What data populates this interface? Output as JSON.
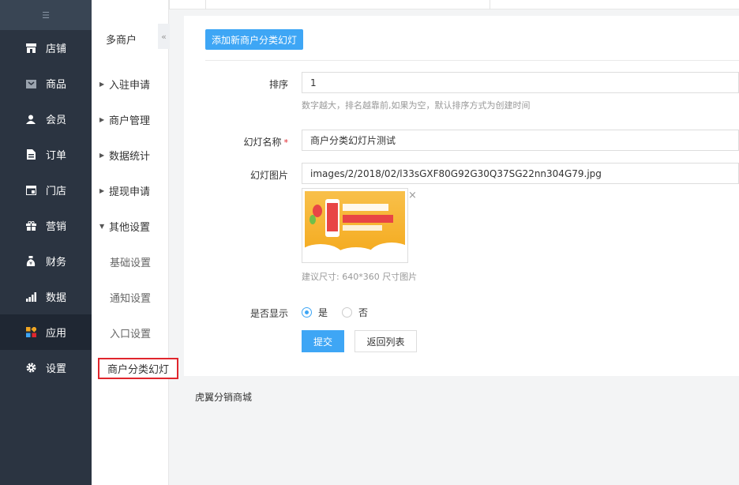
{
  "sidebar": {
    "toggle_glyph": "☰",
    "items": [
      {
        "label": "店铺",
        "icon": "store-icon"
      },
      {
        "label": "商品",
        "icon": "goods-icon"
      },
      {
        "label": "会员",
        "icon": "member-icon"
      },
      {
        "label": "订单",
        "icon": "order-icon"
      },
      {
        "label": "门店",
        "icon": "shop-icon"
      },
      {
        "label": "营销",
        "icon": "gift-icon"
      },
      {
        "label": "财务",
        "icon": "money-bag-icon"
      },
      {
        "label": "数据",
        "icon": "bar-chart-icon"
      },
      {
        "label": "应用",
        "icon": "apps-icon",
        "active": true
      },
      {
        "label": "设置",
        "icon": "gear-icon"
      }
    ]
  },
  "subnav": {
    "title": "多商户",
    "collapse_glyph": "«",
    "groups": [
      {
        "label": "入驻申请",
        "expanded": false
      },
      {
        "label": "商户管理",
        "expanded": false
      },
      {
        "label": "数据统计",
        "expanded": false
      },
      {
        "label": "提现申请",
        "expanded": false
      },
      {
        "label": "其他设置",
        "expanded": true
      }
    ],
    "children": [
      {
        "label": "基础设置"
      },
      {
        "label": "通知设置"
      },
      {
        "label": "入口设置"
      },
      {
        "label": "商户分类幻灯",
        "active": true
      }
    ]
  },
  "form": {
    "add_button": "添加新商户分类幻灯",
    "sort": {
      "label": "排序",
      "value": "1",
      "hint": "数字越大，排名越靠前,如果为空，默认排序方式为创建时间"
    },
    "name": {
      "label": "幻灯名称",
      "required_mark": "*",
      "value": "商户分类幻灯片测试"
    },
    "image": {
      "label": "幻灯图片",
      "value": "images/2/2018/02/l33sGXF80G92G30Q37SG22nn304G79.jpg",
      "hint": "建议尺寸: 640*360 尺寸图片",
      "remove_glyph": "×"
    },
    "display": {
      "label": "是否显示",
      "options": [
        {
          "label": "是",
          "checked": true
        },
        {
          "label": "否",
          "checked": false
        }
      ]
    },
    "submit": "提交",
    "back": "返回列表"
  },
  "footer": {
    "text": "虎翼分销商城"
  },
  "colors": {
    "accent": "#3ea6f5",
    "sidebar": "#2b3441",
    "highlight_border": "#e0262d"
  }
}
